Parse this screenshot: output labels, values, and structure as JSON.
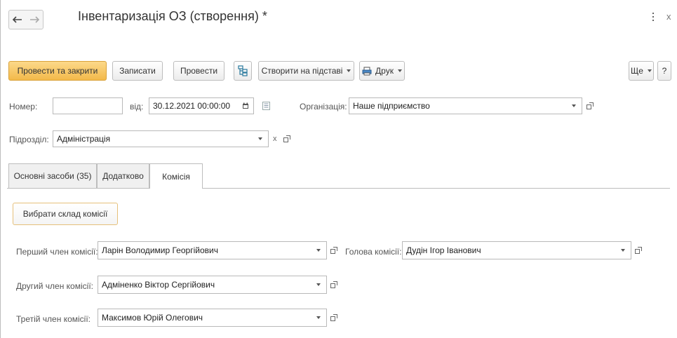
{
  "window": {
    "title": "Інвентаризація ОЗ (створення) *",
    "close_symbol": "x"
  },
  "toolbar": {
    "post_and_close": "Провести та закрити",
    "save": "Записати",
    "post": "Провести",
    "create_based_on": "Створити на підставі",
    "print": "Друк",
    "more": "Ще",
    "help": "?"
  },
  "header": {
    "number_label": "Номер:",
    "number_value": "",
    "date_label": "від:",
    "date_value": "30.12.2021 00:00:00",
    "organization_label": "Організація:",
    "organization_value": "Наше підприємство",
    "department_label": "Підрозділ:",
    "department_value": "Адміністрація",
    "clear_symbol": "x"
  },
  "tabs": [
    {
      "label": "Основні засоби (35)",
      "active": false
    },
    {
      "label": "Додатково",
      "active": false
    },
    {
      "label": "Комісія",
      "active": true
    }
  ],
  "commission": {
    "select_button": "Вибрати склад комісії",
    "member1_label": "Перший член комісії:",
    "member1_value": "Ларін Володимир Георгійович",
    "chair_label": "Голова комісії:",
    "chair_value": "Дудін Ігор Іванович",
    "member2_label": "Другий член комісії:",
    "member2_value": "Адміненко Віктор Сергійович",
    "member3_label": "Третій член комісії:",
    "member3_value": "Максимов Юрій Олегович"
  },
  "colors": {
    "primary_button": "#f3b94a",
    "border": "#bdbdbd"
  },
  "icons": [
    "back-arrow-icon",
    "forward-arrow-icon",
    "structure-icon",
    "printer-icon",
    "calendar-icon",
    "document-list-icon",
    "open-link-icon",
    "dropdown-icon"
  ]
}
